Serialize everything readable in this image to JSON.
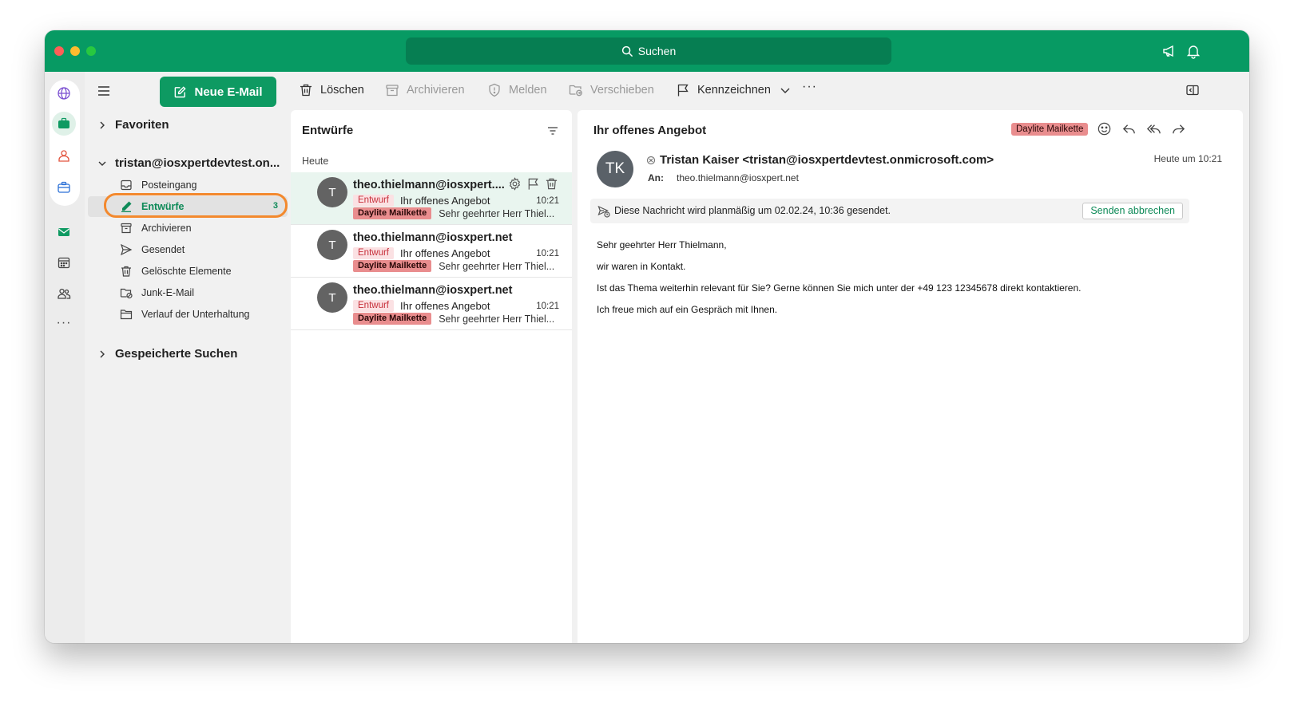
{
  "search": {
    "placeholder": "Suchen"
  },
  "toolbar": {
    "delete": "Löschen",
    "archive": "Archivieren",
    "report": "Melden",
    "move": "Verschieben",
    "flag": "Kennzeichnen",
    "more": "···"
  },
  "new_mail": "Neue E-Mail",
  "folders": {
    "favorites": "Favoriten",
    "account": "tristan@iosxpertdevtest.on...",
    "items": [
      {
        "label": "Posteingang"
      },
      {
        "label": "Entwürfe",
        "count": "3"
      },
      {
        "label": "Archivieren"
      },
      {
        "label": "Gesendet"
      },
      {
        "label": "Gelöschte Elemente"
      },
      {
        "label": "Junk-E-Mail"
      },
      {
        "label": "Verlauf der Unterhaltung"
      }
    ],
    "saved_searches": "Gespeicherte Suchen"
  },
  "list": {
    "title": "Entwürfe",
    "group": "Heute",
    "messages": [
      {
        "initial": "T",
        "from": "theo.thielmann@iosxpert....",
        "draft": "Entwurf",
        "subject": "Ihr offenes Angebot",
        "time": "10:21",
        "label": "Daylite Mailkette",
        "preview": "Sehr geehrter Herr Thiel..."
      },
      {
        "initial": "T",
        "from": "theo.thielmann@iosxpert.net",
        "draft": "Entwurf",
        "subject": "Ihr offenes Angebot",
        "time": "10:21",
        "label": "Daylite Mailkette",
        "preview": "Sehr geehrter Herr Thiel..."
      },
      {
        "initial": "T",
        "from": "theo.thielmann@iosxpert.net",
        "draft": "Entwurf",
        "subject": "Ihr offenes Angebot",
        "time": "10:21",
        "label": "Daylite Mailkette",
        "preview": "Sehr geehrter Herr Thiel..."
      }
    ]
  },
  "reader": {
    "subject": "Ihr offenes Angebot",
    "tag": "Daylite Mailkette",
    "avatar": "TK",
    "sender": "Tristan Kaiser <tristan@iosxpertdevtest.onmicrosoft.com>",
    "to_label": "An:",
    "to": "theo.thielmann@iosxpert.net",
    "time": "Heute um 10:21",
    "schedule_text": "Diese Nachricht wird planmäßig um 02.02.24, 10:36 gesendet.",
    "cancel_send": "Senden abbrechen",
    "body": [
      "Sehr geehrter Herr Thielmann,",
      "wir waren in Kontakt.",
      "Ist das Thema weiterhin relevant für Sie? Gerne können Sie mich unter der +49 123 12345678 direkt kontaktieren.",
      "Ich freue mich auf ein Gespräch mit Ihnen."
    ]
  },
  "colors": {
    "brand": "#079a63",
    "accent": "#0e8a58",
    "highlight": "#f3892e",
    "label": "#e98d8e"
  }
}
